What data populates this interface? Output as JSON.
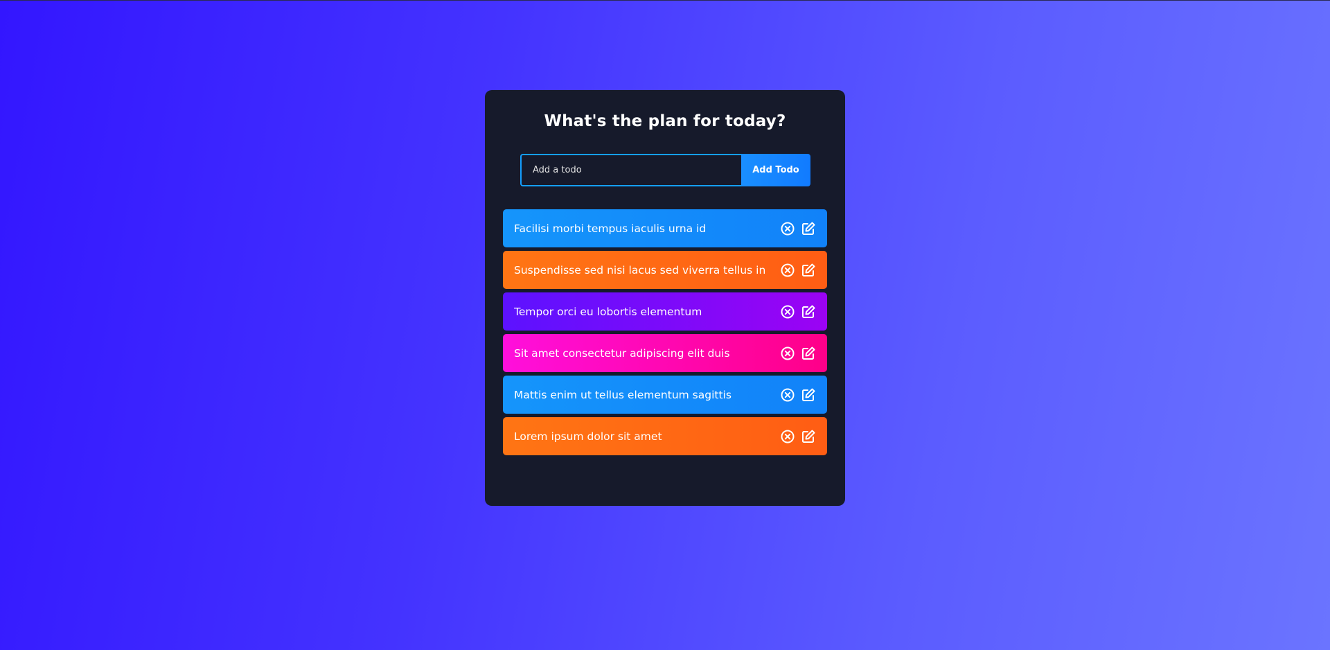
{
  "app": {
    "title": "What's the plan for today?"
  },
  "form": {
    "input_placeholder": "Add a todo",
    "input_value": "",
    "button_label": "Add Todo"
  },
  "todos": [
    {
      "text": "Facilisi morbi tempus iaculis urna id",
      "color": "blue"
    },
    {
      "text": "Suspendisse sed nisi lacus sed viverra tellus in",
      "color": "orange"
    },
    {
      "text": "Tempor orci eu lobortis elementum",
      "color": "purple"
    },
    {
      "text": "Sit amet consectetur adipiscing elit duis",
      "color": "pink"
    },
    {
      "text": "Mattis enim ut tellus elementum sagittis",
      "color": "blue"
    },
    {
      "text": "Lorem ipsum dolor sit amet",
      "color": "orange"
    }
  ],
  "icons": {
    "delete": "close-circle-icon",
    "edit": "edit-icon"
  },
  "colors": {
    "background_start": "#3316ff",
    "background_end": "#6b74ff",
    "card": "#161a2b",
    "accent": "#149fff",
    "blue": "#1595fb",
    "orange": "#ff6a14",
    "purple": "#7a0bf9",
    "pink": "#ff08b3"
  }
}
